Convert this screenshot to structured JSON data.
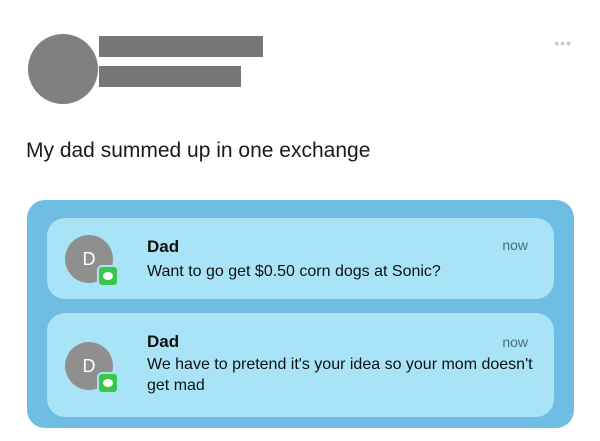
{
  "post": {
    "text": "My dad summed up in one exchange",
    "more_icon": "more-dots-icon"
  },
  "notifications": [
    {
      "avatar_letter": "D",
      "sender": "Dad",
      "time": "now",
      "message": "Want to go get $0.50 corn dogs at Sonic?",
      "app_icon": "messages-icon"
    },
    {
      "avatar_letter": "D",
      "sender": "Dad",
      "time": "now",
      "message": "We have to pretend it's your idea so your mom doesn't get mad",
      "app_icon": "messages-icon"
    }
  ],
  "colors": {
    "panel_bg": "#6fbde3",
    "notification_bg": "#a8e3f7",
    "messages_green": "#37c84b",
    "redaction_gray": "#777777"
  }
}
